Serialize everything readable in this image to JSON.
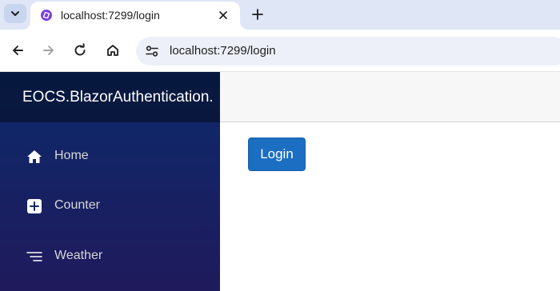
{
  "browser": {
    "tab": {
      "title": "localhost:7299/login"
    },
    "address_bar": {
      "url": "localhost:7299/login"
    }
  },
  "app": {
    "brand": "EOCS.BlazorAuthentication.",
    "nav": [
      {
        "label": "Home",
        "icon": "home-icon"
      },
      {
        "label": "Counter",
        "icon": "plus-square-icon"
      },
      {
        "label": "Weather",
        "icon": "list-icon"
      }
    ],
    "login_button": "Login"
  },
  "colors": {
    "sidebar_top": "#0c2a6b",
    "sidebar_bottom": "#1f1a5c",
    "button_primary": "#1b6ec2",
    "tabstrip": "#dfe6f5"
  }
}
